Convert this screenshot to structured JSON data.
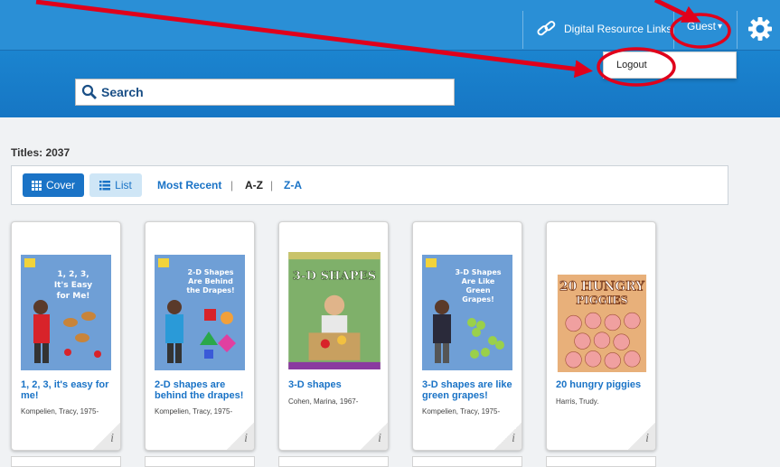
{
  "header": {
    "digital_resource_links": "Digital Resource Links",
    "guest": "Guest",
    "caret": "▾",
    "dropdown_logout": "Logout"
  },
  "search": {
    "label": "Search"
  },
  "results": {
    "titles_label": "Titles: 2037"
  },
  "toolbar": {
    "cover_label": "Cover",
    "list_label": "List",
    "sort_most_recent": "Most Recent",
    "sort_az": "A-Z",
    "sort_za": "Z-A",
    "separator": "|"
  },
  "books": [
    {
      "title": "1, 2, 3, it's easy for me!",
      "author": "Kompelien, Tracy, 1975-",
      "cover_text": "1, 2, 3, It's Easy for Me!"
    },
    {
      "title": "2-D shapes are behind the drapes!",
      "author": "Kompelien, Tracy, 1975-",
      "cover_text": "2-D Shapes Are Behind the Drapes!"
    },
    {
      "title": "3-D shapes",
      "author": "Cohen, Marina, 1967-",
      "cover_text": "3-D SHAPES"
    },
    {
      "title": "3-D shapes are like green grapes!",
      "author": "Kompelien, Tracy, 1975-",
      "cover_text": "3-D Shapes Are Like Green Grapes!"
    },
    {
      "title": "20 hungry piggies",
      "author": "Harris, Trudy.",
      "cover_text": "20 HUNGRY PIGGIES"
    }
  ],
  "colors": {
    "accent": "#1a73c6",
    "annotation": "#e0001b"
  }
}
